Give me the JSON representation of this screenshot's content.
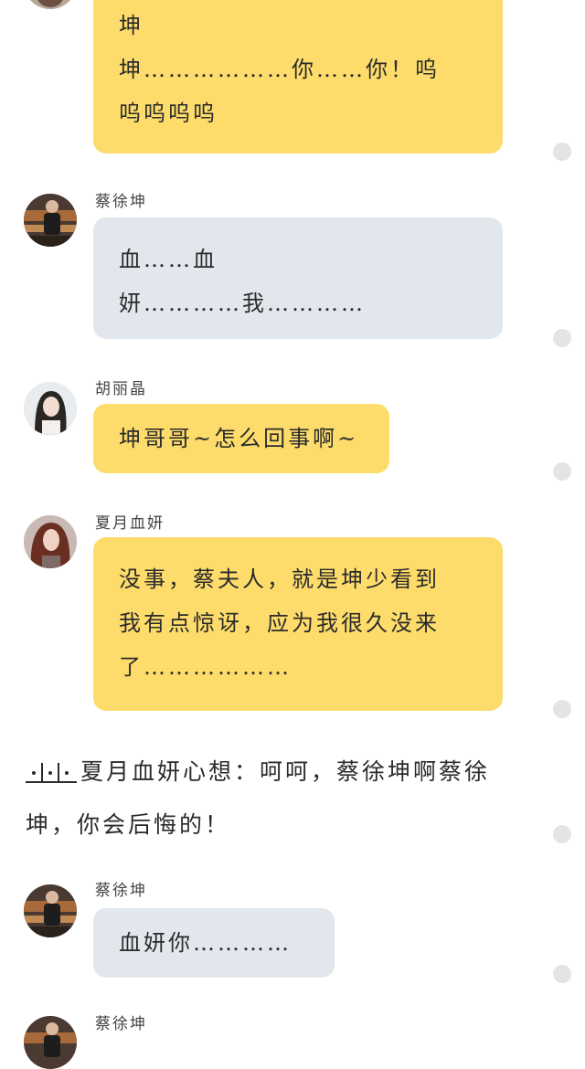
{
  "messages": [
    {
      "id": "m1",
      "speaker": "",
      "lines": [
        "坤",
        "坤………………你……你！呜",
        "呜呜呜呜"
      ],
      "bubble_color": "#fddc6b"
    },
    {
      "id": "m2",
      "speaker": "蔡徐坤",
      "lines": [
        "血……血",
        "妍…………我…………"
      ],
      "bubble_color": "#e1e7ec"
    },
    {
      "id": "m3",
      "speaker": "胡丽晶",
      "lines": [
        "坤哥哥~怎么回事啊~"
      ],
      "bubble_color": "#fddc6b"
    },
    {
      "id": "m4",
      "speaker": "夏月血妍",
      "lines": [
        "没事，蔡夫人，就是坤少看到",
        "我有点惊讶，应为我很久没来",
        "了………………"
      ],
      "bubble_color": "#fddc6b"
    },
    {
      "id": "m5",
      "speaker": "蔡徐坤",
      "lines": [
        "血妍你…………"
      ],
      "bubble_color": "#e1e7ec"
    },
    {
      "id": "m6",
      "speaker": "蔡徐坤",
      "lines": [],
      "bubble_color": "#e1e7ec"
    }
  ],
  "narration": {
    "lines": [
      "夏月血妍心想：呵呵，蔡徐坤啊蔡徐",
      "坤，你会后悔的！"
    ]
  },
  "colors": {
    "yellow_bubble": "#fddc6b",
    "gray_bubble": "#e1e7ec",
    "background": "#ffffff",
    "dot": "#e4e4e4"
  },
  "icons": {
    "avatar_kun": "avatar-photo-cai-xukun",
    "avatar_hu": "avatar-photo-hu-lijing",
    "avatar_xia": "avatar-photo-xia-yue-xueyan",
    "narration_marker": "pause-dots-icon",
    "side_dot": "side-dot-icon"
  }
}
